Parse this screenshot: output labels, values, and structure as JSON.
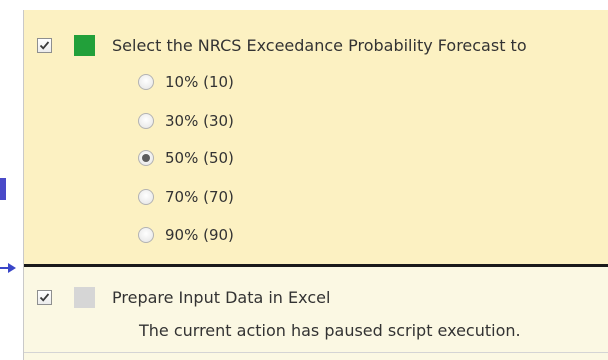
{
  "steps": [
    {
      "checked": true,
      "status_color": "#22a03a",
      "title": "Select the NRCS Exceedance Probability Forecast to",
      "options": [
        {
          "label": "10% (10)",
          "selected": false
        },
        {
          "label": "30% (30)",
          "selected": false
        },
        {
          "label": "50% (50)",
          "selected": true
        },
        {
          "label": "70% (70)",
          "selected": false
        },
        {
          "label": "90% (90)",
          "selected": false
        }
      ]
    },
    {
      "checked": true,
      "status_color": "#d6d6d6",
      "title": "Prepare Input Data in Excel",
      "message": "The current action has paused script execution."
    }
  ],
  "colors": {
    "active_step_bg": "#fcf1c2",
    "paused_step_bg": "#fbf8e3",
    "current_step_divider": "#1a1a1a",
    "pointer_arrow": "#3a46c8"
  },
  "icons": {
    "checkbox": "checkmark-icon",
    "status": "status-square-icon",
    "pointer": "arrow-right-icon"
  }
}
